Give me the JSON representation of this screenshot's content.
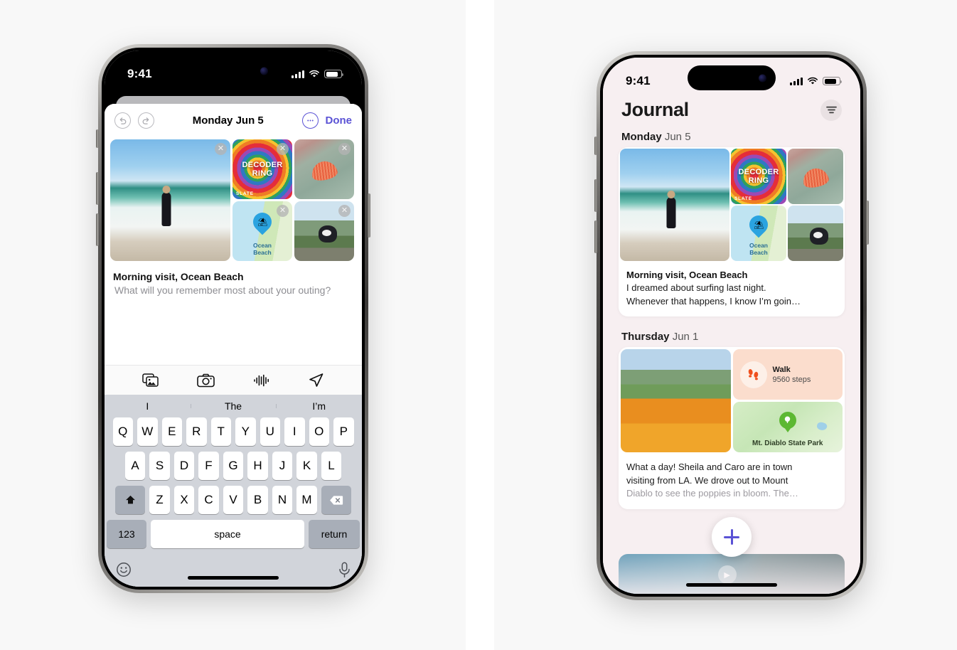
{
  "left_phone": {
    "status_bar": {
      "time": "9:41",
      "cellular": "signal-bars",
      "wifi": "wifi-icon",
      "battery": "battery-icon"
    },
    "navbar": {
      "undo_label": "↺",
      "redo_label": "↻",
      "title": "Monday Jun 5",
      "more_label": "•••",
      "done_label": "Done"
    },
    "attachments": [
      {
        "name": "surfer-photo",
        "alt": "Person in wetsuit walking on beach",
        "remove_label": "✕"
      },
      {
        "name": "decoder-ring-podcast",
        "title_line1": "DECODER",
        "title_line2": "RING",
        "brand": "SLATE",
        "remove_label": "✕"
      },
      {
        "name": "seashell-photo",
        "alt": "Orange seashell on mossy rock",
        "remove_label": "✕"
      },
      {
        "name": "ocean-beach-map",
        "label_line1": "Ocean",
        "label_line2": "Beach",
        "pin_glyph": "⛱",
        "remove_label": "✕"
      },
      {
        "name": "dog-photo",
        "alt": "Dog looking out car window",
        "remove_label": "✕"
      }
    ],
    "entry": {
      "title": "Morning visit, Ocean Beach",
      "placeholder": "What will you remember most about your outing?"
    },
    "attach_bar": [
      {
        "name": "photos-icon",
        "label": "Photos"
      },
      {
        "name": "camera-icon",
        "label": "Camera"
      },
      {
        "name": "audio-waveform-icon",
        "label": "Audio"
      },
      {
        "name": "location-arrow-icon",
        "label": "Location"
      }
    ],
    "keyboard": {
      "predictions": [
        "I",
        "The",
        "I’m"
      ],
      "row1": [
        "Q",
        "W",
        "E",
        "R",
        "T",
        "Y",
        "U",
        "I",
        "O",
        "P"
      ],
      "row2": [
        "A",
        "S",
        "D",
        "F",
        "G",
        "H",
        "J",
        "K",
        "L"
      ],
      "row3": [
        "Z",
        "X",
        "C",
        "V",
        "B",
        "N",
        "M"
      ],
      "shift_label": "⇧",
      "backspace_label": "⌫",
      "numbers_label": "123",
      "space_label": "space",
      "return_label": "return",
      "emoji_label": "☺",
      "dictation_label": "mic"
    }
  },
  "right_phone": {
    "status_bar": {
      "time": "9:41",
      "cellular": "signal-bars",
      "wifi": "wifi-icon",
      "battery": "battery-icon"
    },
    "header": {
      "title": "Journal",
      "filter_label": "sort-filter-icon"
    },
    "entries": [
      {
        "day": "Monday",
        "date": "Jun 5",
        "media": [
          {
            "name": "surfer-photo",
            "alt": "Person in wetsuit walking on beach"
          },
          {
            "name": "decoder-ring-podcast",
            "title_line1": "DECODER",
            "title_line2": "RING",
            "brand": "SLATE"
          },
          {
            "name": "seashell-photo",
            "alt": "Orange seashell on mossy rock"
          },
          {
            "name": "ocean-beach-map",
            "label_line1": "Ocean",
            "label_line2": "Beach",
            "pin_glyph": "⛱"
          },
          {
            "name": "dog-photo",
            "alt": "Dog looking out car window"
          }
        ],
        "title": "Morning visit, Ocean Beach",
        "line1": "I dreamed about surfing last night.",
        "line2": "Whenever that happens, I know I’m goin…"
      },
      {
        "day": "Thursday",
        "date": "Jun 1",
        "media": [
          {
            "name": "poppy-field-photo",
            "alt": "Hillside of orange poppies"
          }
        ],
        "widgets": {
          "walk": {
            "name": "walk-widget",
            "title": "Walk",
            "value": "9560 steps",
            "icon": "footprints-icon"
          },
          "map": {
            "name": "location-widget",
            "label": "Mt. Diablo State Park",
            "icon": "tree-pin-icon"
          }
        },
        "line1": "What a day! Sheila and Caro are in town",
        "line2": "visiting from LA. We drove out to Mount",
        "line3": "Diablo to see the poppies in bloom. The…"
      }
    ],
    "fab": {
      "name": "new-entry-button",
      "label": "+"
    },
    "next_card": {
      "name": "partial-next-entry",
      "play_label": "▶"
    }
  },
  "colors": {
    "accent_purple": "#5a52d5",
    "journal_bg": "#f7eff1",
    "keyboard_bg": "#d1d4da",
    "walk_widget_bg": "#fbddcd",
    "walk_icon": "#f0501e",
    "map_pin_green": "#5cb832"
  }
}
